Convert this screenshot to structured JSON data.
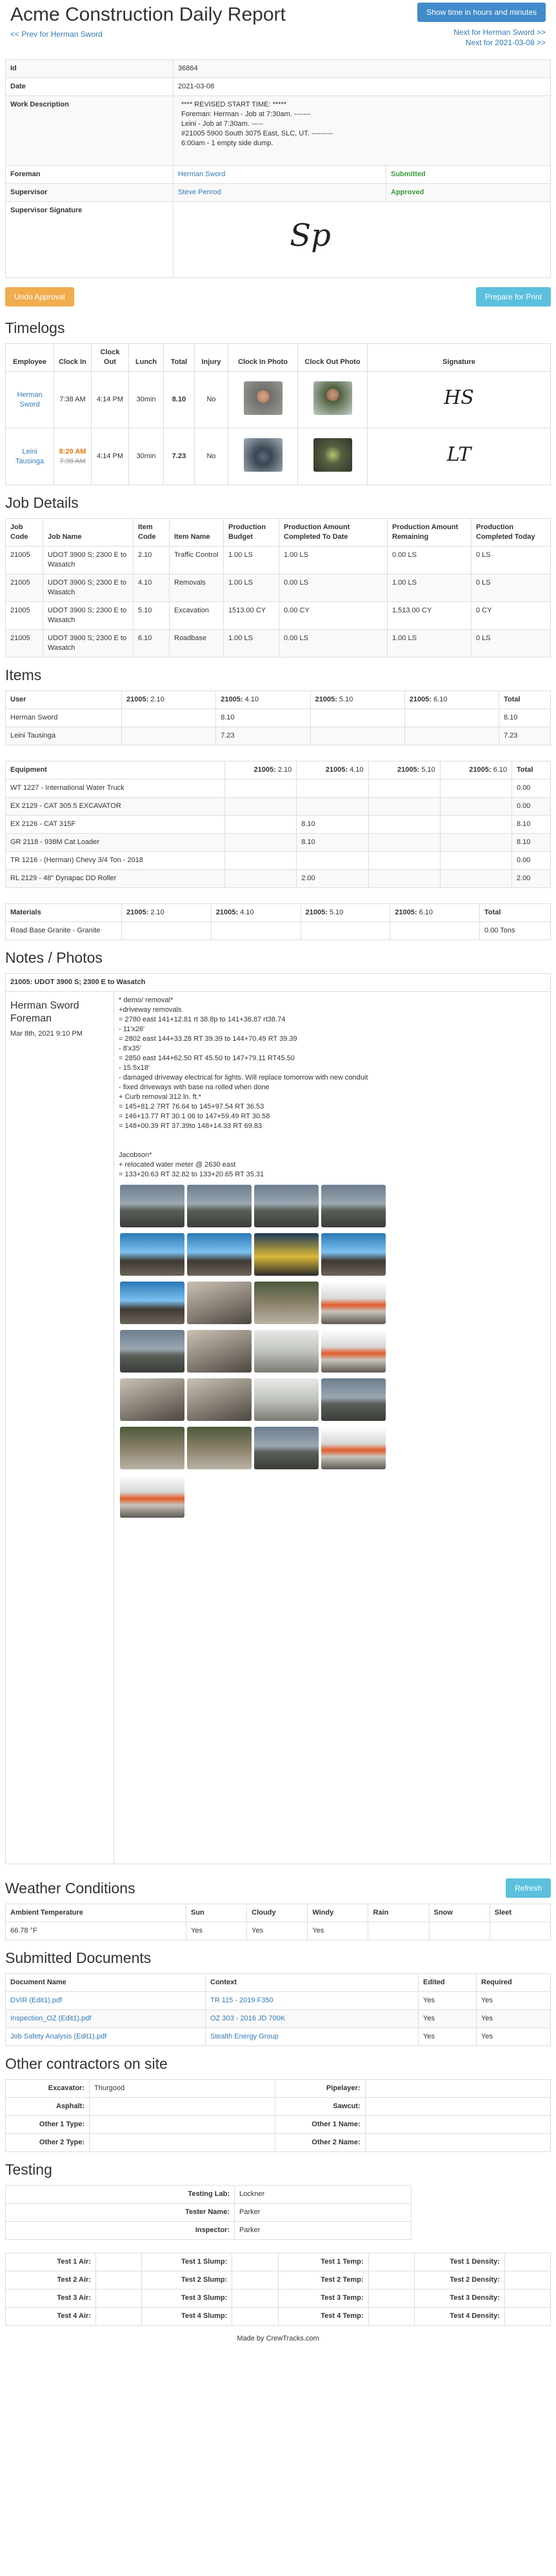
{
  "header": {
    "title": "Acme Construction Daily Report",
    "show_time_button": "Show time in hours and minutes",
    "prev_link": "<< Prev for Herman Sword",
    "next_foreman_link": "Next for Herman Sword >>",
    "next_date_link": "Next for 2021-03-08 >>"
  },
  "summary": {
    "id_label": "Id",
    "id_value": "36864",
    "date_label": "Date",
    "date_value": "2021-03-08",
    "work_label": "Work Description",
    "work_lines": [
      "**** REVISED START TIME: *****",
      "Foreman: Herman - Job at 7:30am. -------",
      "Leini - Job at 7:30am. -----",
      "#21005 5900 South 3075 East, SLC, UT. ---------",
      "6:00am - 1 empty side dump."
    ],
    "foreman_label": "Foreman",
    "foreman_value": "Herman Sword",
    "foreman_status": "Submitted",
    "supervisor_label": "Supervisor",
    "supervisor_value": "Steve Penrod",
    "supervisor_status": "Approved",
    "signature_label": "Supervisor Signature",
    "signature_text": "Sp"
  },
  "actions": {
    "undo_approval": "Undo Approval",
    "prepare_print": "Prepare for Print"
  },
  "timelogs": {
    "title": "Timelogs",
    "headers": [
      "Employee",
      "Clock In",
      "Clock Out",
      "Lunch",
      "Total",
      "Injury",
      "Clock In Photo",
      "Clock Out Photo",
      "Signature"
    ],
    "rows": [
      {
        "employee": "Herman Sword",
        "clock_in": "7:38 AM",
        "clock_in_old": "",
        "clock_out": "4:14 PM",
        "lunch": "30min",
        "total": "8.10",
        "injury": "No",
        "signature": "HS"
      },
      {
        "employee": "Leini Tausinga",
        "clock_in": "8:20 AM",
        "clock_in_old": "7:38 AM",
        "clock_out": "4:14 PM",
        "lunch": "30min",
        "total": "7.23",
        "injury": "No",
        "signature": "LT"
      }
    ]
  },
  "job_details": {
    "title": "Job Details",
    "headers": [
      "Job Code",
      "Job Name",
      "Item Code",
      "Item Name",
      "Production Budget",
      "Production Amount Completed To Date",
      "Production Amount Remaining",
      "Production Completed Today"
    ],
    "rows": [
      [
        "21005",
        "UDOT 3900 S; 2300 E to Wasatch",
        "2.10",
        "Traffic Control",
        "1.00 LS",
        "1.00 LS",
        "0.00 LS",
        "0 LS"
      ],
      [
        "21005",
        "UDOT 3900 S; 2300 E to Wasatch",
        "4.10",
        "Removals",
        "1.00 LS",
        "0.00 LS",
        "1.00 LS",
        "0 LS"
      ],
      [
        "21005",
        "UDOT 3900 S; 2300 E to Wasatch",
        "5.10",
        "Excavation",
        "1513.00 CY",
        "0.00 CY",
        "1,513.00 CY",
        "0 CY"
      ],
      [
        "21005",
        "UDOT 3900 S; 2300 E to Wasatch",
        "6.10",
        "Roadbase",
        "1.00 LS",
        "0.00 LS",
        "1.00 LS",
        "0 LS"
      ]
    ]
  },
  "items": {
    "title": "Items",
    "user_header": "User",
    "col_headers": [
      {
        "code": "21005:",
        "sub": "2.10"
      },
      {
        "code": "21005:",
        "sub": "4.10"
      },
      {
        "code": "21005:",
        "sub": "5.10"
      },
      {
        "code": "21005:",
        "sub": "6.10"
      }
    ],
    "total_header": "Total",
    "user_rows": [
      {
        "name": "Herman Sword",
        "cells": [
          "",
          "8.10",
          "",
          ""
        ],
        "total": "8.10"
      },
      {
        "name": "Leini Tausinga",
        "cells": [
          "",
          "7.23",
          "",
          ""
        ],
        "total": "7.23"
      }
    ],
    "equipment_header": "Equipment",
    "equipment_rows": [
      {
        "name": "WT 1227 - International Water Truck",
        "cells": [
          "",
          "",
          "",
          ""
        ],
        "total": "0.00"
      },
      {
        "name": "EX 2129 - CAT 305.5 EXCAVATOR",
        "cells": [
          "",
          "",
          "",
          ""
        ],
        "total": "0.00"
      },
      {
        "name": "EX 2126 - CAT 315F",
        "cells": [
          "",
          "8.10",
          "",
          ""
        ],
        "total": "8.10"
      },
      {
        "name": "GR 2118 - 938M Cat Loader",
        "cells": [
          "",
          "8.10",
          "",
          ""
        ],
        "total": "8.10"
      },
      {
        "name": "TR 1216 - (Herman) Chevy 3/4 Ton - 2018",
        "cells": [
          "",
          "",
          "",
          ""
        ],
        "total": "0.00"
      },
      {
        "name": "RL 2129 - 48\" Dynapac DD Roller",
        "cells": [
          "",
          "2.00",
          "",
          ""
        ],
        "total": "2.00"
      }
    ],
    "materials_header": "Materials",
    "material_rows": [
      {
        "name": "Road Base Granite - Granite",
        "cells": [
          "",
          "",
          "",
          ""
        ],
        "total": "0.00 Tons"
      }
    ]
  },
  "notes": {
    "title": "Notes / Photos",
    "job_header": "21005: UDOT 3900 S; 2300 E to Wasatch",
    "author": "Herman Sword",
    "role": "Foreman",
    "timestamp": "Mar 8th, 2021 9:10 PM",
    "text": "* demo/ removal*\n+driveway removals\n= 2780 east 141+12.81 rt 38.8p to 141+38.87 rt38.74\n- 11'x26'\n= 2802 east 144+33.28 RT 39.39 to 144+70.49 RT 39.39\n- 8'x35'\n= 2850 east 144+62.50 RT 45.50 to 147+79.11 RT45.50\n- 15.5x18'\n- damaged driveway electrical for lights. Will replace tomorrow with new conduit\n- fixed driveways with base na rolled when done\n+ Curb removal 312 ln. ft.*\n= 145+81.2 7RT 76.64 to 145+97.54 RT 36.53\n= 146+13.77 RT 30.1 06 to 147+59.49 RT 30.58\n= 148+00.39 RT 37.39to 148+14.33 RT 69.83\n\n\nJacobson*\n+ relocated water meter @ 2630 east\n= 133+20.63 RT 32.82 to 133+20.65 RT 35.31",
    "photos": [
      "a",
      "a",
      "a",
      "a",
      "b",
      "b",
      "g",
      "b",
      "b",
      "c",
      "d",
      "f",
      "a",
      "c",
      "e",
      "f",
      "c",
      "c",
      "e",
      "a",
      "d",
      "d",
      "a",
      "f",
      "f"
    ]
  },
  "weather": {
    "title": "Weather Conditions",
    "refresh": "Refresh",
    "headers": [
      "Ambient Temperature",
      "Sun",
      "Cloudy",
      "Windy",
      "Rain",
      "Snow",
      "Sleet"
    ],
    "values": [
      "66.78 °F",
      "Yes",
      "Yes",
      "Yes",
      "",
      "",
      ""
    ]
  },
  "documents": {
    "title": "Submitted Documents",
    "headers": [
      "Document Name",
      "Context",
      "Edited",
      "Required"
    ],
    "rows": [
      {
        "name": "DVIR (Edit1).pdf",
        "context": "TR 115 - 2019 F350",
        "edited": "Yes",
        "required": "Yes"
      },
      {
        "name": "Inspection_OZ (Edit1).pdf",
        "context": "OZ 303 - 2016 JD 700K",
        "edited": "Yes",
        "required": "Yes"
      },
      {
        "name": "Job Safety Analysis (Edit1).pdf",
        "context": "Stealth Energy Group",
        "edited": "Yes",
        "required": "Yes"
      }
    ]
  },
  "contractors": {
    "title": "Other contractors on site",
    "rows": [
      {
        "l1": "Excavator:",
        "v1": "Thurgood",
        "l2": "Pipelayer:",
        "v2": ""
      },
      {
        "l1": "Asphalt:",
        "v1": "",
        "l2": "Sawcut:",
        "v2": ""
      },
      {
        "l1": "Other 1 Type:",
        "v1": "",
        "l2": "Other 1 Name:",
        "v2": ""
      },
      {
        "l1": "Other 2 Type:",
        "v1": "",
        "l2": "Other 2 Name:",
        "v2": ""
      }
    ]
  },
  "testing": {
    "title": "Testing",
    "lab_label": "Testing Lab:",
    "lab_value": "Lockner",
    "tester_label": "Tester Name:",
    "tester_value": "Parker",
    "inspector_label": "Inspector:",
    "inspector_value": "Parker",
    "test_rows": [
      [
        "Test 1 Air:",
        "Test 1 Slump:",
        "Test 1 Temp:",
        "Test 1 Density:"
      ],
      [
        "Test 2 Air:",
        "Test 2 Slump:",
        "Test 2 Temp:",
        "Test 2 Density:"
      ],
      [
        "Test 3 Air:",
        "Test 3 Slump:",
        "Test 3 Temp:",
        "Test 3 Density:"
      ],
      [
        "Test 4 Air:",
        "Test 4 Slump:",
        "Test 4 Temp:",
        "Test 4 Density:"
      ]
    ]
  },
  "footer": {
    "text": "Made by CrewTracks.com"
  }
}
